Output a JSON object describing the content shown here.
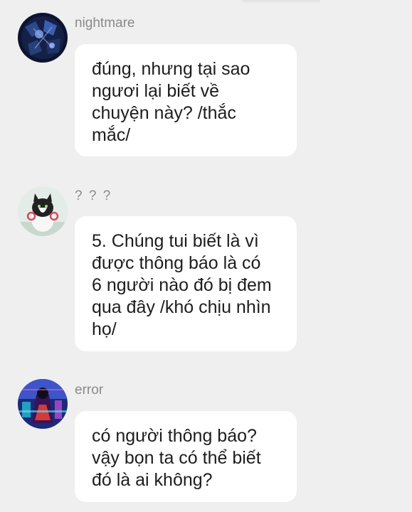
{
  "messages": [
    {
      "username": "nightmare",
      "avatar_icon": "dark-blue-character-avatar",
      "text": "đúng, nhưng tại sao\nngươi lại biết về\nchuyện này? /thắc\nmắc/"
    },
    {
      "username": "? ? ?",
      "avatar_icon": "black-white-cat-avatar",
      "text": "5. Chúng tui biết là vì\nđược thông báo là có\n6 người nào đó bị đem\nqua đây /khó chịu nhìn\nhọ/"
    },
    {
      "username": "error",
      "avatar_icon": "purple-blue-glitch-avatar",
      "text": "có người thông báo?\nvậy bọn ta có thể biết\nđó là ai không?"
    }
  ],
  "colors": {
    "background": "#efefef",
    "bubble": "#ffffff",
    "username": "#8a8a8a",
    "text": "#1d1d1d"
  }
}
